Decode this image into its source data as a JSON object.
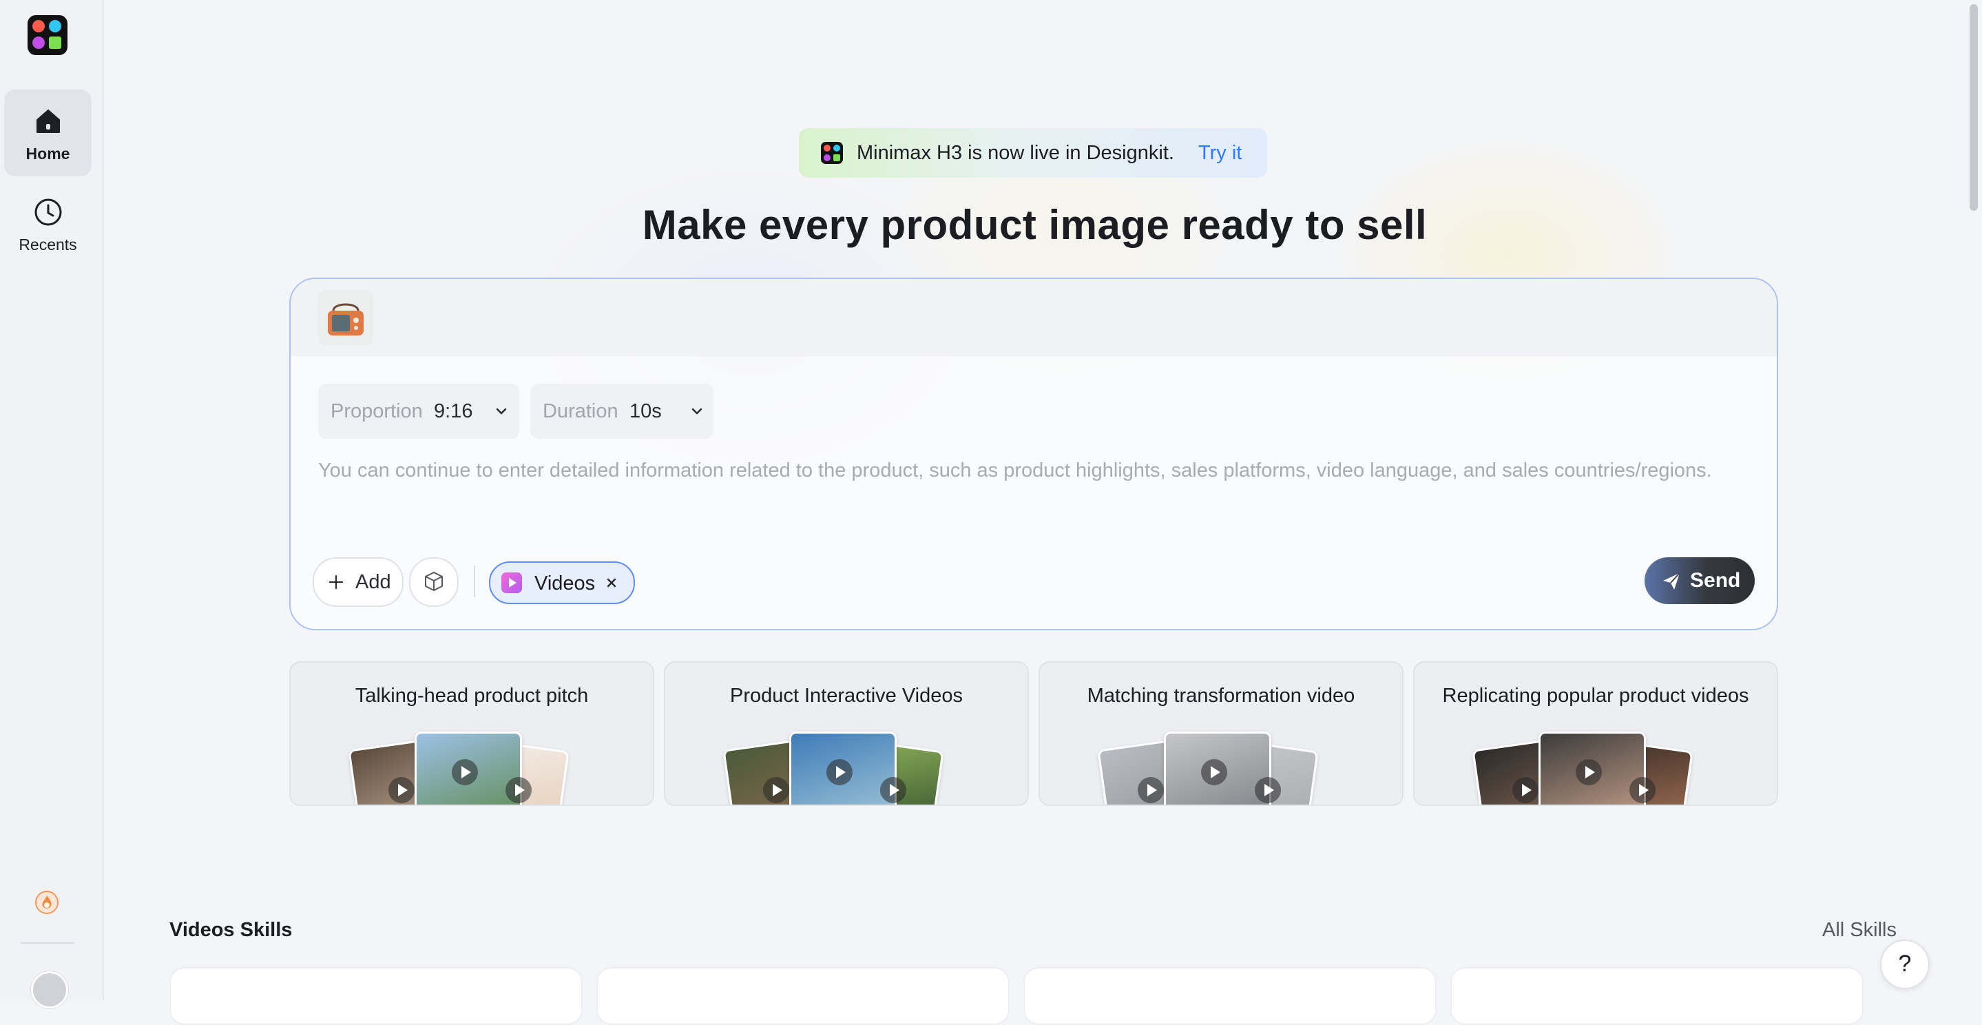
{
  "sidebar": {
    "items": [
      {
        "label": "Home",
        "icon": "home-icon",
        "active": true
      },
      {
        "label": "Recents",
        "icon": "clock-icon",
        "active": false
      }
    ],
    "bottom_icon": "flame-icon"
  },
  "banner": {
    "text": "Minimax H3 is now live in Designkit.",
    "link": "Try it"
  },
  "headline": "Make every product image ready to sell",
  "composer": {
    "proportion": {
      "label": "Proportion",
      "value": "9:16"
    },
    "duration": {
      "label": "Duration",
      "value": "10s"
    },
    "prompt_placeholder": "You can continue to enter detailed information related to the product, such as product highlights, sales platforms, video language, and sales countries/regions.",
    "add_label": "Add",
    "chip_label": "Videos",
    "send_label": "Send"
  },
  "skill_cards": [
    {
      "title": "Talking-head product pitch"
    },
    {
      "title": "Product Interactive Videos"
    },
    {
      "title": "Matching transformation video"
    },
    {
      "title": "Replicating popular product videos"
    }
  ],
  "section": {
    "title": "Videos Skills",
    "all_link": "All Skills"
  },
  "help_label": "?",
  "colors": {
    "accent": "#2f7df6",
    "composer_border": "#a9c4f4",
    "chip_border": "#5b8ef0"
  }
}
